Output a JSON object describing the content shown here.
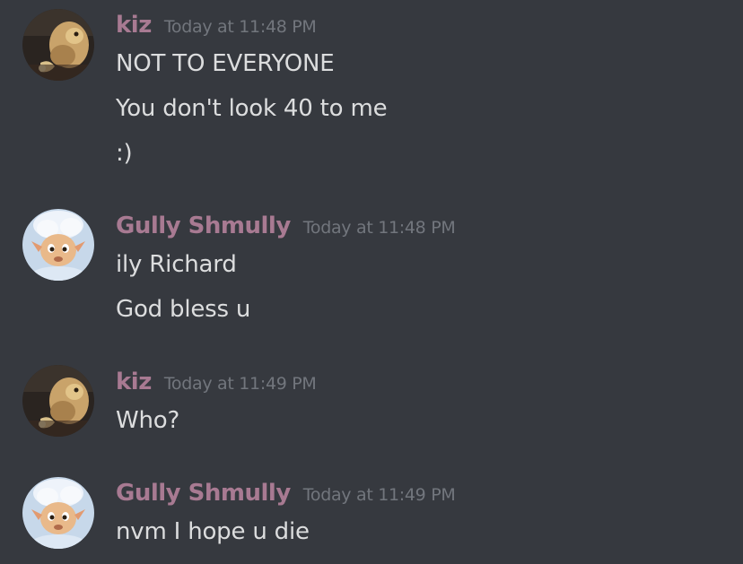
{
  "colors": {
    "background": "#36393f",
    "username": "#a87a92",
    "timestamp": "#72767d",
    "message_text": "#dcddde"
  },
  "groups": [
    {
      "avatar_icon": "monkey-avatar-icon",
      "username": "kiz",
      "timestamp": "Today at 11:48 PM",
      "lines": [
        "NOT TO EVERYONE",
        "You don't look 40 to me",
        ":)"
      ]
    },
    {
      "avatar_icon": "lamb-avatar-icon",
      "username": "Gully Shmully",
      "timestamp": "Today at 11:48 PM",
      "lines": [
        "ily Richard",
        "God bless u"
      ]
    },
    {
      "avatar_icon": "monkey-avatar-icon",
      "username": "kiz",
      "timestamp": "Today at 11:49 PM",
      "lines": [
        "Who?"
      ]
    },
    {
      "avatar_icon": "lamb-avatar-icon",
      "username": "Gully Shmully",
      "timestamp": "Today at 11:49 PM",
      "lines": [
        "nvm I hope u die"
      ]
    }
  ]
}
